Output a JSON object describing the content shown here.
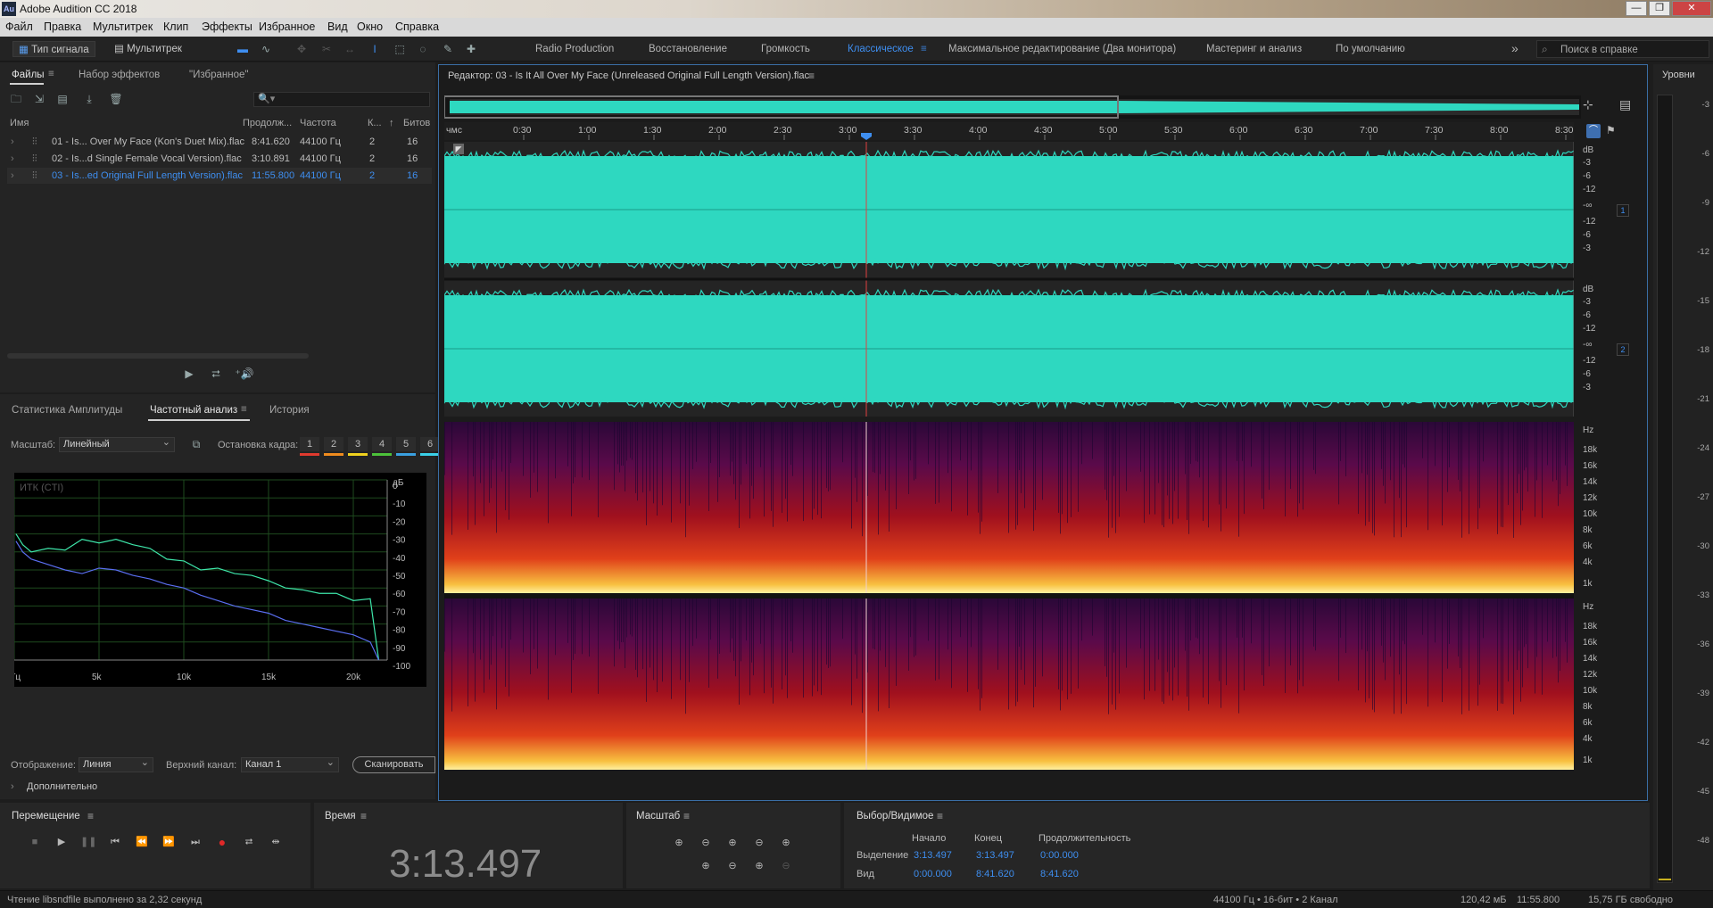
{
  "window": {
    "app_icon": "Au",
    "title": "Adobe Audition CC 2018",
    "controls": [
      "—",
      "❐",
      "✕"
    ]
  },
  "menu": [
    "Файл",
    "Правка",
    "Мультитрек",
    "Клип",
    "Эффекты",
    "Избранное",
    "Вид",
    "Окно",
    "Справка"
  ],
  "toolbar": {
    "waveform_btn": "Тип сигнала",
    "multitrack_btn": "Мультитрек",
    "workspaces": [
      "Radio Production",
      "Восстановление",
      "Громкость",
      "Классическое",
      "Максимальное редактирование (Два монитора)",
      "Мастеринг и анализ",
      "По умолчанию"
    ],
    "active_workspace": "Классическое",
    "search_placeholder": "Поиск в справке",
    "more": "»"
  },
  "files_panel": {
    "tabs": [
      "Файлы",
      "Набор эффектов",
      "\"Избранное\""
    ],
    "columns": [
      "Имя",
      "Продолж...",
      "Частота",
      "К...",
      "Битов"
    ],
    "rows": [
      {
        "name": "01 - Is... Over My Face (Kon's Duet Mix).flac",
        "duration": "8:41.620",
        "rate": "44100 Гц",
        "ch": "2",
        "bits": "16"
      },
      {
        "name": "02 - Is...d Single Female Vocal Version).flac",
        "duration": "3:10.891",
        "rate": "44100 Гц",
        "ch": "2",
        "bits": "16"
      },
      {
        "name": "03 - Is...ed Original Full Length Version).flac",
        "duration": "11:55.800",
        "rate": "44100 Гц",
        "ch": "2",
        "bits": "16"
      }
    ],
    "search_icon": "🔍▾"
  },
  "analysis_panel": {
    "tabs": [
      "Статистика Амплитуды",
      "Частотный анализ",
      "История"
    ],
    "scale_label": "Масштаб:",
    "scale_value": "Линейный",
    "freeze_label": "Остановка кадра:",
    "freeze_slots": [
      "1",
      "2",
      "3",
      "4",
      "5",
      "6"
    ],
    "freeze_colors": [
      "#e03a2e",
      "#f08c1e",
      "#f0d21e",
      "#4cc23a",
      "#3aa0e0",
      "#3ad0e8"
    ],
    "plot_label": "ИТК (CTI)",
    "db_unit": "дБ",
    "db_ticks": [
      "0",
      "-10",
      "-20",
      "-30",
      "-40",
      "-50",
      "-60",
      "-70",
      "-80",
      "-90",
      "-100"
    ],
    "freq_ticks": [
      "Гц",
      "5k",
      "10k",
      "15k",
      "20k"
    ],
    "display_label": "Отображение:",
    "display_value": "Линия",
    "channel_label": "Верхний канал:",
    "channel_value": "Канал 1",
    "scan_btn": "Сканировать",
    "advanced": "Дополнительно"
  },
  "editor": {
    "title": "Редактор: 03 - Is It All Over My Face (Unreleased Original Full Length Version).flac",
    "time_labels": [
      "чмс",
      "0:30",
      "1:00",
      "1:30",
      "2:00",
      "2:30",
      "3:00",
      "3:30",
      "4:00",
      "4:30",
      "5:00",
      "5:30",
      "6:00",
      "6:30",
      "7:00",
      "7:30",
      "8:00",
      "8:30"
    ],
    "db_labels": [
      "dB",
      "-3",
      "-6",
      "-12",
      "-∞",
      "-12",
      "-6",
      "-3"
    ],
    "channels": [
      "1",
      "2"
    ],
    "hz_labels": [
      "Hz",
      "18k",
      "16k",
      "14k",
      "12k",
      "10k",
      "8k",
      "6k",
      "4k",
      "1k"
    ]
  },
  "meters": {
    "title": "Уровни",
    "ticks": [
      "-3",
      "-6",
      "-9",
      "-12",
      "-15",
      "-18",
      "-21",
      "-24",
      "-27",
      "-30",
      "-33",
      "-36",
      "-39",
      "-42",
      "-45",
      "-48"
    ]
  },
  "transport": {
    "title": "Перемещение"
  },
  "time_panel": {
    "title": "Время",
    "value": "3:13.497"
  },
  "zoom_panel": {
    "title": "Масштаб"
  },
  "selection_panel": {
    "title": "Выбор/Видимое",
    "headers": [
      "Начало",
      "Конец",
      "Продолжительность"
    ],
    "rows": [
      {
        "label": "Выделение",
        "start": "3:13.497",
        "end": "3:13.497",
        "duration": "0:00.000"
      },
      {
        "label": "Вид",
        "start": "0:00.000",
        "end": "8:41.620",
        "duration": "8:41.620"
      }
    ]
  },
  "status": {
    "message": "Чтение libsndfile выполнено за 2,32 секунд",
    "format": "44100 Гц • 16-бит • 2 Канал",
    "size": "120,42 мБ",
    "duration": "11:55.800",
    "free": "15,75 ГБ свободно"
  },
  "colors": {
    "accent": "#3e8ef0",
    "waveform": "#2ed8c0",
    "playhead": "#e04040"
  },
  "chart_data": {
    "type": "line",
    "xlabel": "Гц",
    "ylabel": "дБ",
    "xlim": [
      0,
      22000
    ],
    "ylim": [
      -100,
      0
    ],
    "series": [
      {
        "x": [
          100,
          500,
          1000,
          2000,
          3000,
          4000,
          5000,
          6000,
          7000,
          8000,
          9000,
          10000,
          11000,
          12000,
          13000,
          14000,
          15000,
          16000,
          17000,
          18000,
          19000,
          20000,
          21000,
          21500
        ],
        "values": [
          -30,
          -36,
          -40,
          -38,
          -39,
          -33,
          -35,
          -33,
          -36,
          -38,
          -44,
          -45,
          -50,
          -49,
          -52,
          -53,
          -56,
          -60,
          -61,
          -63,
          -63,
          -67,
          -66,
          -100
        ]
      },
      {
        "x": [
          100,
          500,
          1000,
          2000,
          3000,
          4000,
          5000,
          6000,
          7000,
          8000,
          9000,
          10000,
          11000,
          12000,
          13000,
          14000,
          15000,
          16000,
          17000,
          18000,
          19000,
          20000,
          21000,
          21500
        ],
        "values": [
          -34,
          -40,
          -44,
          -47,
          -50,
          -52,
          -49,
          -50,
          -53,
          -55,
          -58,
          -60,
          -64,
          -67,
          -70,
          -72,
          -74,
          -78,
          -80,
          -82,
          -84,
          -86,
          -90,
          -100
        ]
      }
    ]
  }
}
